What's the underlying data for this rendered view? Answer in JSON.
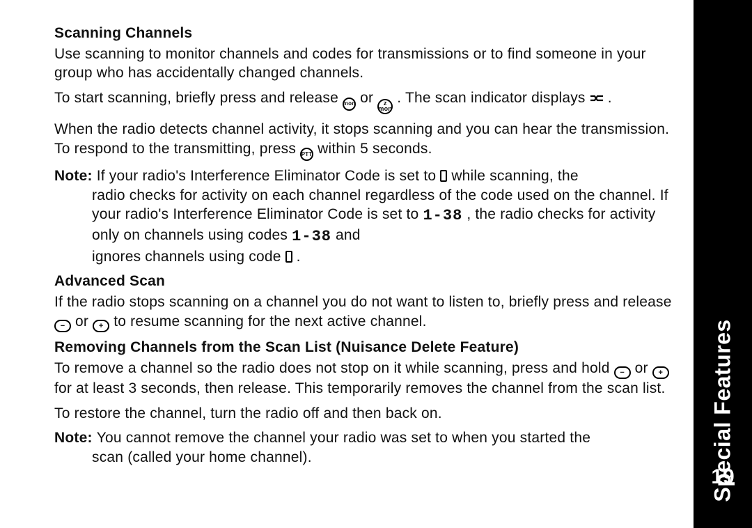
{
  "sidebar": {
    "sectionTitle": "Special Features",
    "pageNumber": "19"
  },
  "glyphs": {
    "mon": "mon",
    "zmon": "ᴢ",
    "zmon2": "mon",
    "ptt": "PTT",
    "minus": "−",
    "plus": "+"
  },
  "sec1": {
    "title": "Scanning Channels",
    "p1": "Use scanning to monitor channels and codes for transmissions or to find someone in your group who has accidentally changed channels.",
    "p2a": "To start scanning, briefly press and release ",
    "p2b": " or ",
    "p2c": ". The scan indicator displays ",
    "p2d": " .",
    "p3a": "When the radio detects channel activity, it stops scanning and you can hear the transmission. To respond to the transmitting, press ",
    "p3b": " within 5 seconds.",
    "noteLead": "Note: ",
    "note1a": "If your radio's Interference Eliminator Code is set to ",
    "note1b": " while scanning, the",
    "note2": "radio checks for activity on each channel regardless of the code used on the channel. If your radio's Interference Eliminator Code is set to ",
    "note2b": ", the radio checks for activity only on channels using codes ",
    "note2c": " and",
    "note3": "ignores channels using code ",
    "note3b": " .",
    "code0": "0",
    "codeRange": "1-38"
  },
  "sec2": {
    "title": "Advanced Scan",
    "p1a": "If the radio stops scanning on a channel you do not want to listen to, briefly press and release ",
    "p1b": " or ",
    "p1c": " to resume scanning for the next active channel."
  },
  "sec3": {
    "title": "Removing Channels from the Scan List (Nuisance Delete Feature)",
    "p1a": "To remove a channel so the radio does not stop on it while scanning, press and hold ",
    "p1b": " or ",
    "p1c": " for at least 3 seconds, then release. This temporarily removes the channel from the scan list.",
    "p2": "To restore the channel, turn the radio off and then back on.",
    "noteLead": "Note: ",
    "note1": "You cannot remove the channel your radio was set to when you started the",
    "note2": "scan (called your home channel)."
  }
}
